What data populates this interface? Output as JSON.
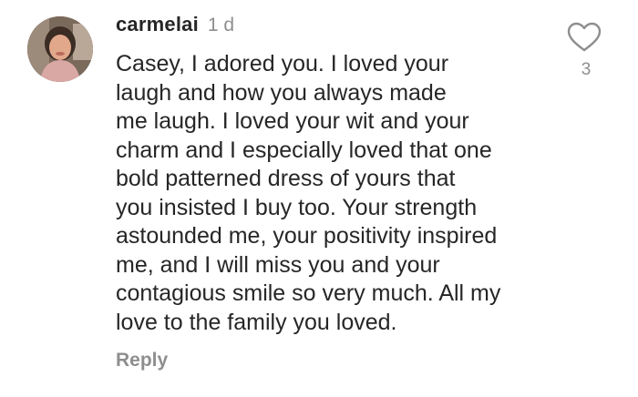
{
  "comment": {
    "avatar_icon": "user-avatar",
    "username": "carmelai",
    "timestamp": "1 d",
    "text": "Casey, I adored you. I loved your\nlaugh and how you always made\nme laugh. I loved your wit and your\ncharm and I especially loved that one\nbold patterned dress of yours that\nyou insisted I buy too. Your strength\nastounded me, your positivity inspired\nme, and I will miss you and your\ncontagious smile so very much. All my\nlove to the family you loved.",
    "reply_label": "Reply",
    "like_icon": "heart-icon",
    "like_count": "3"
  },
  "colors": {
    "text": "#262626",
    "muted": "#8e8e8e",
    "background": "#ffffff"
  }
}
